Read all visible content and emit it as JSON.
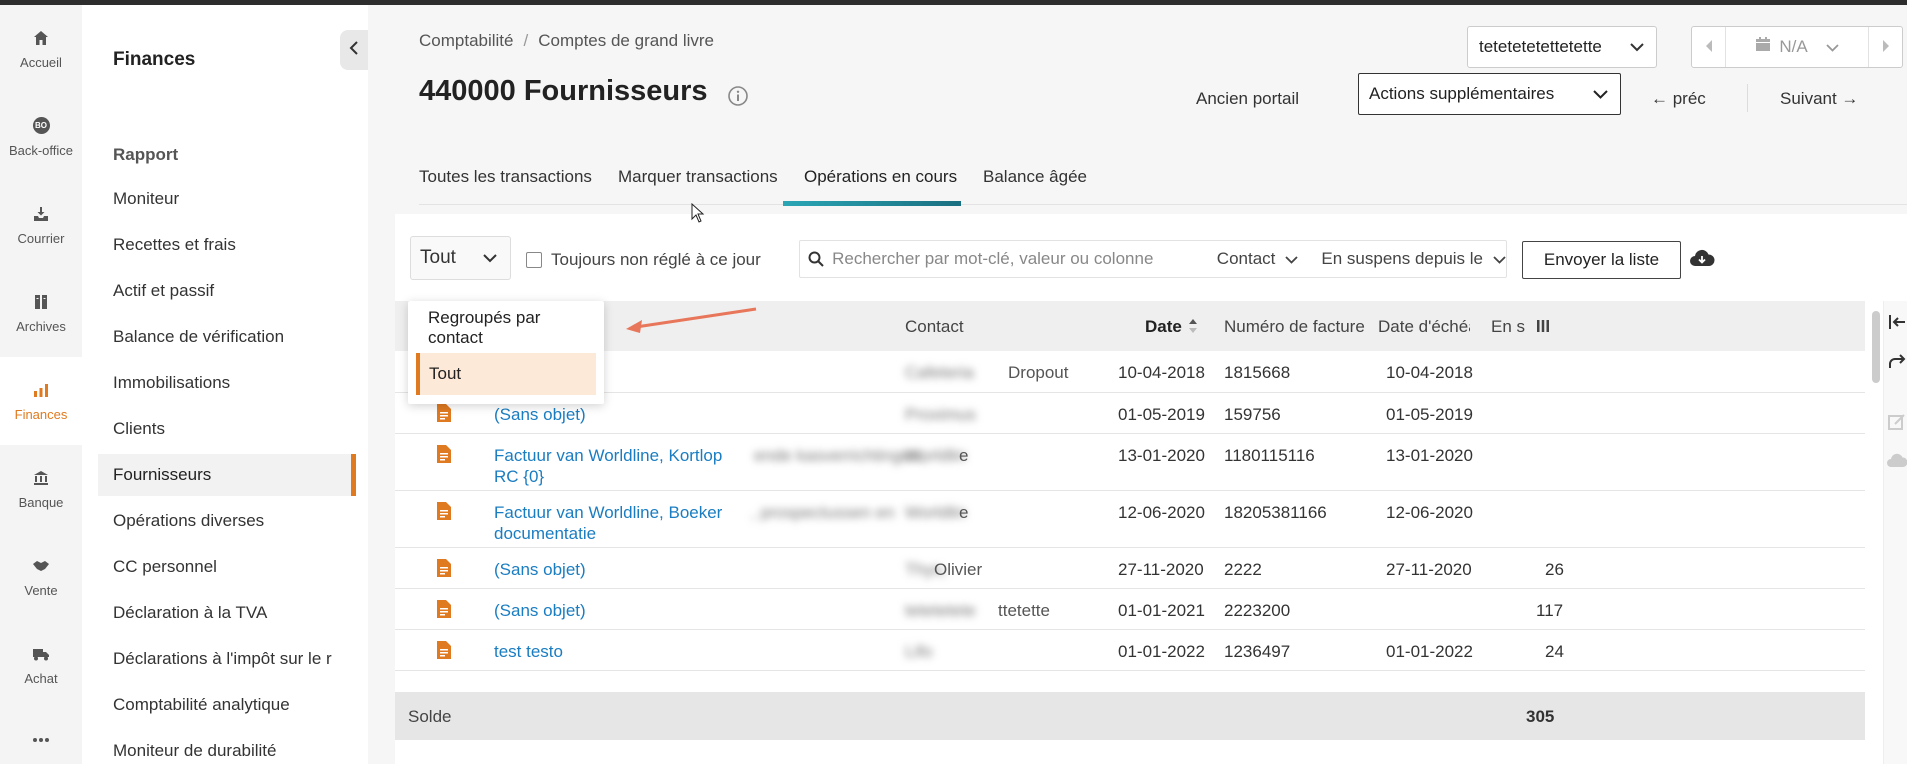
{
  "rail": {
    "items": [
      {
        "label": "Accueil",
        "icon": "home-icon"
      },
      {
        "label": "Back-office",
        "icon": "bo-icon"
      },
      {
        "label": "Courrier",
        "icon": "inbox-icon"
      },
      {
        "label": "Archives",
        "icon": "archive-icon"
      },
      {
        "label": "Finances",
        "icon": "chart-icon",
        "active": true
      },
      {
        "label": "Banque",
        "icon": "bank-icon"
      },
      {
        "label": "Vente",
        "icon": "handshake-icon"
      },
      {
        "label": "Achat",
        "icon": "truck-icon"
      },
      {
        "label": "",
        "icon": "more-icon"
      }
    ],
    "bo_badge": "BO"
  },
  "sidebar": {
    "title": "Finances",
    "section": "Rapport",
    "items": [
      "Moniteur",
      "Recettes et frais",
      "Actif et passif",
      "Balance de vérification",
      "Immobilisations",
      "Clients",
      "Fournisseurs",
      "Opérations diverses",
      "CC personnel",
      "Déclaration à la TVA",
      "Déclarations à l'impôt sur le r",
      "Comptabilité analytique",
      "Moniteur de durabilité"
    ],
    "active_item": "Fournisseurs"
  },
  "header": {
    "breadcrumb": [
      "Comptabilité",
      "/",
      "Comptes de grand livre"
    ],
    "title": "440000 Fournisseurs",
    "company": "tetetetetettetette",
    "period": "N/A",
    "old_portal": "Ancien portail",
    "more_actions": "Actions supplémentaires",
    "prev": "← préc",
    "next": "Suivant →"
  },
  "tabs": [
    {
      "label": "Toutes les transactions"
    },
    {
      "label": "Marquer transactions"
    },
    {
      "label": "Opérations en cours",
      "active": true
    },
    {
      "label": "Balance âgée"
    }
  ],
  "toolbar": {
    "filter_value": "Tout",
    "checkbox_label": "Toujours non réglé à ce jour",
    "search_placeholder": "Rechercher par mot-clé, valeur ou colonne",
    "contact_dd": "Contact",
    "suspense_dd": "En suspens depuis le",
    "send_list": "Envoyer la liste"
  },
  "dropdown": {
    "options": [
      "Regroupés par contact",
      "Tout"
    ],
    "selected": "Tout"
  },
  "table": {
    "columns": [
      "Contact",
      "Date",
      "Numéro de facture",
      "Date d'échéa",
      "En s"
    ],
    "rows": [
      {
        "desc": "",
        "desc_blur": "",
        "contact": "Dropout",
        "contact_blur": "Cafeteria ",
        "date": "10-04-2018",
        "invoice": "1815668",
        "due": "10-04-2018",
        "amount": ""
      },
      {
        "desc": "(Sans objet)",
        "desc_blur": "",
        "contact": "",
        "contact_blur": "Proximus",
        "date": "01-05-2019",
        "invoice": "159756",
        "due": "01-05-2019",
        "amount": ""
      },
      {
        "desc": "Factuur van Worldline, Kortlop",
        "desc_blur": "ende kasverrichtingen,",
        "desc2": "RC {0}",
        "contact": "e",
        "contact_blur": "Worldlin",
        "date": "13-01-2020",
        "invoice": "1180115116",
        "due": "13-01-2020",
        "amount": ""
      },
      {
        "desc": "Factuur van Worldline, Boeker",
        "desc_blur": ", prospectussen en",
        "desc2": "documentatie",
        "contact": "e",
        "contact_blur": "Worldlin",
        "date": "12-06-2020",
        "invoice": "18205381166",
        "due": "12-06-2020",
        "amount": ""
      },
      {
        "desc": "(Sans objet)",
        "desc_blur": "",
        "contact": "Olivier",
        "contact_blur": "Thys, ",
        "date": "27-11-2020",
        "invoice": "2222",
        "due": "27-11-2020",
        "amount": "26"
      },
      {
        "desc": "(Sans objet)",
        "desc_blur": "",
        "contact": "ttetette",
        "contact_blur": "tetetetete",
        "date": "01-01-2021",
        "invoice": "2223200",
        "due": "",
        "amount": "117"
      },
      {
        "desc": "test testo",
        "desc_blur": "",
        "contact": "",
        "contact_blur": "Lifo",
        "date": "01-01-2022",
        "invoice": "1236497",
        "due": "01-01-2022",
        "amount": "24"
      }
    ]
  },
  "footer": {
    "label": "Solde",
    "amount": "305"
  },
  "colors": {
    "accent": "#e07a20",
    "link": "#1a7dc2",
    "tab_bar": "#2aa6b5",
    "arrow": "#e8765a"
  }
}
